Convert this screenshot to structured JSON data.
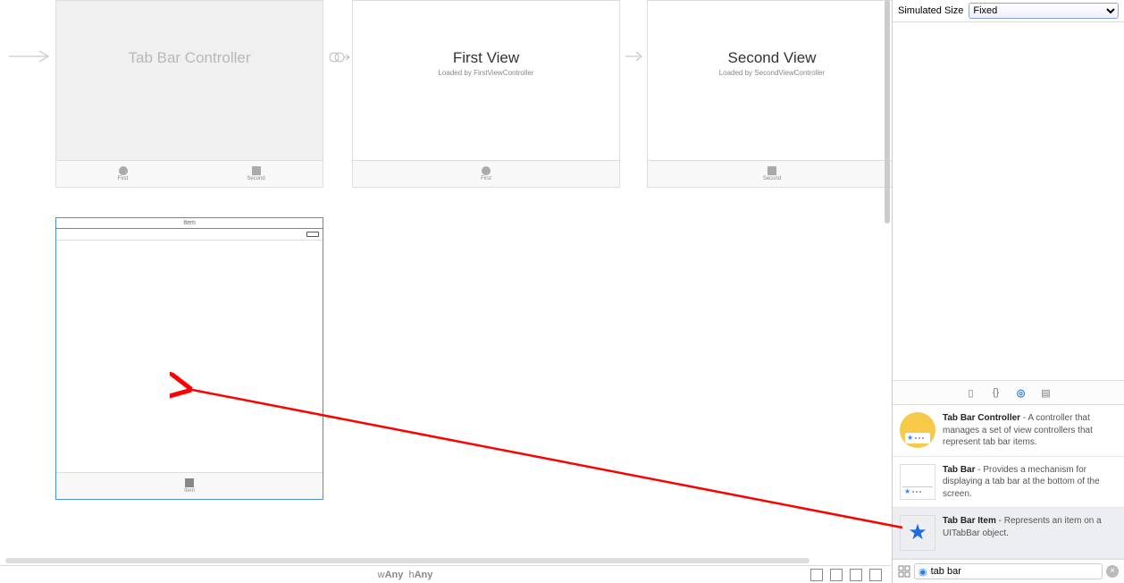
{
  "scenes": {
    "tabctrl": {
      "title": "Tab Bar Controller",
      "tab1": "First",
      "tab2": "Second"
    },
    "first": {
      "title": "First View",
      "sub": "Loaded by FirstViewController",
      "tab": "First"
    },
    "second": {
      "title": "Second View",
      "sub": "Loaded by SecondViewController",
      "tab": "Second"
    },
    "item": {
      "title": "Item",
      "tab": "Item"
    }
  },
  "sizeclass": {
    "w_prefix": "w",
    "w": "Any",
    "h_prefix": "h",
    "h": "Any"
  },
  "inspector": {
    "simsize_label": "Simulated Size",
    "simsize_value": "Fixed"
  },
  "library": {
    "items": [
      {
        "title": "Tab Bar Controller",
        "desc": " - A controller that manages a set of view controllers that represent tab bar items."
      },
      {
        "title": "Tab Bar",
        "desc": " - Provides a mechanism for displaying a tab bar at the bottom of the screen."
      },
      {
        "title": "Tab Bar Item",
        "desc": " - Represents an item on a UITabBar object."
      }
    ],
    "search": "tab bar"
  }
}
